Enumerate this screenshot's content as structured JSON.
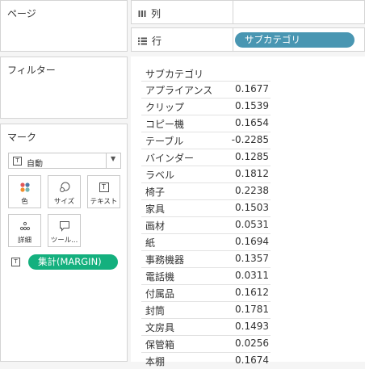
{
  "pages": {
    "title": "ページ"
  },
  "filters": {
    "title": "フィルター"
  },
  "marks": {
    "title": "マーク",
    "mark_type": "自動",
    "buttons": [
      {
        "label": "色",
        "icon": "color-icon"
      },
      {
        "label": "サイズ",
        "icon": "size-icon"
      },
      {
        "label": "テキスト",
        "icon": "text-icon"
      },
      {
        "label": "詳細",
        "icon": "detail-icon"
      },
      {
        "label": "ツール...",
        "icon": "tooltip-icon"
      }
    ],
    "text_pill": "集計(MARGIN)"
  },
  "columns_shelf": {
    "label": "列"
  },
  "rows_shelf": {
    "label": "行",
    "pill": "サブカテゴリ"
  },
  "table": {
    "header": "サブカテゴリ",
    "rows": [
      {
        "category": "アプライアンス",
        "value": "0.1677"
      },
      {
        "category": "クリップ",
        "value": "0.1539"
      },
      {
        "category": "コピー機",
        "value": "0.1654"
      },
      {
        "category": "テーブル",
        "value": "-0.2285"
      },
      {
        "category": "バインダー",
        "value": "0.1285"
      },
      {
        "category": "ラベル",
        "value": "0.1812"
      },
      {
        "category": "椅子",
        "value": "0.2238"
      },
      {
        "category": "家具",
        "value": "0.1503"
      },
      {
        "category": "画材",
        "value": "0.0531"
      },
      {
        "category": "紙",
        "value": "0.1694"
      },
      {
        "category": "事務機器",
        "value": "0.1357"
      },
      {
        "category": "電話機",
        "value": "0.0311"
      },
      {
        "category": "付属品",
        "value": "0.1612"
      },
      {
        "category": "封筒",
        "value": "0.1781"
      },
      {
        "category": "文房具",
        "value": "0.1493"
      },
      {
        "category": "保管箱",
        "value": "0.0256"
      },
      {
        "category": "本棚",
        "value": "0.1674"
      }
    ]
  },
  "colors": {
    "dimension_pill": "#4996b2",
    "measure_pill": "#14b07e"
  }
}
